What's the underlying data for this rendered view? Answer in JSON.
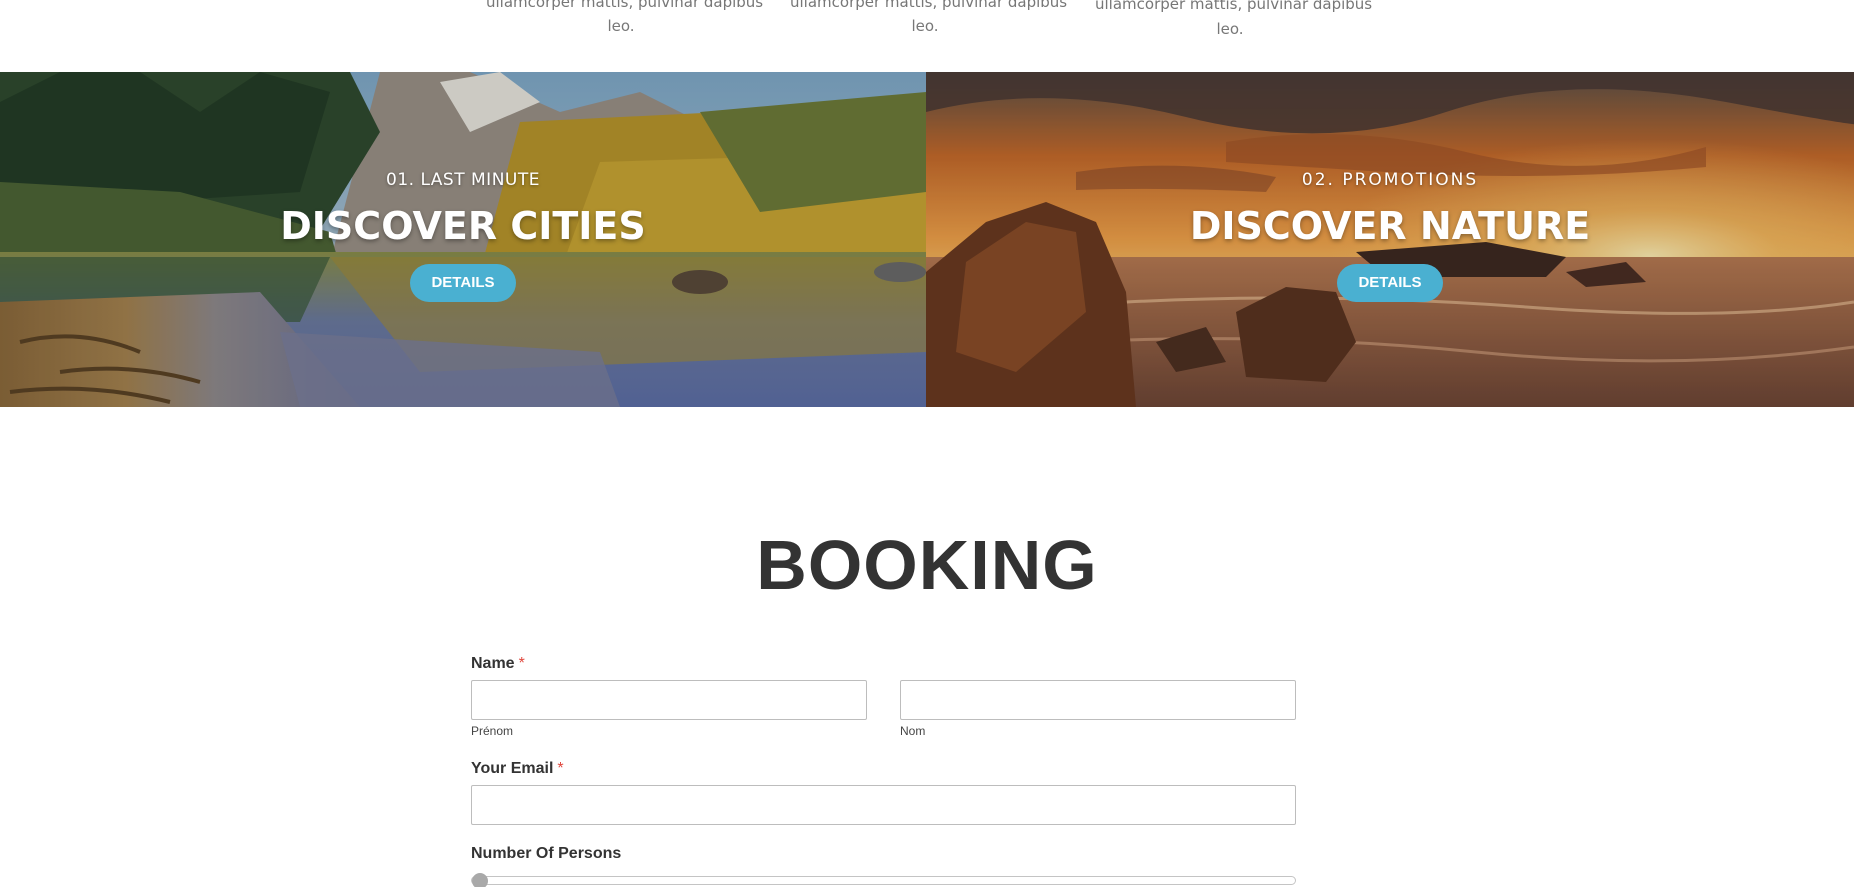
{
  "top_columns": [
    {
      "line1": "ullamcorper mattis, pulvinar dapibus",
      "line2": "leo."
    },
    {
      "line1": "ullamcorper mattis, pulvinar dapibus",
      "line2": "leo."
    },
    {
      "line1": "ullamcorper mattis, pulvinar dapibus",
      "line2": "leo."
    }
  ],
  "promos": [
    {
      "kicker": "01. LAST MINUTE",
      "headline": "DISCOVER CITIES",
      "button": "DETAILS"
    },
    {
      "kicker": "02. PROMOTIONS",
      "headline": "DISCOVER NATURE",
      "button": "DETAILS"
    }
  ],
  "booking": {
    "title": "BOOKING",
    "name_label": "Name",
    "required_mark": "*",
    "first_name_value": "",
    "last_name_value": "",
    "first_name_sublabel": "Prénom",
    "last_name_sublabel": "Nom",
    "email_label": "Your Email",
    "email_value": "",
    "persons_label": "Number Of Persons",
    "persons_slider_level": 0
  },
  "colors": {
    "accent": "#4ab0d1",
    "required": "#e0453b",
    "heading": "#333333"
  }
}
